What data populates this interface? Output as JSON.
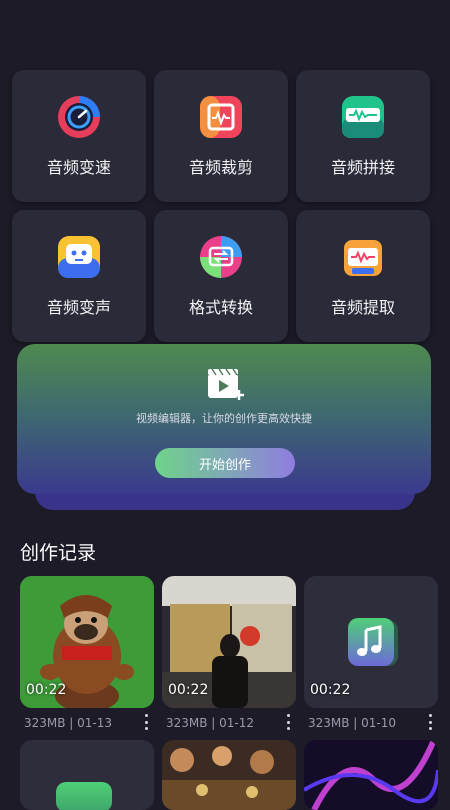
{
  "tools": [
    {
      "label": "音频变速",
      "icon": "speed-dial-icon"
    },
    {
      "label": "音频裁剪",
      "icon": "crop-audio-icon"
    },
    {
      "label": "音频拼接",
      "icon": "splice-audio-icon"
    },
    {
      "label": "音频变声",
      "icon": "voice-change-robot-icon"
    },
    {
      "label": "格式转换",
      "icon": "format-convert-icon"
    },
    {
      "label": "音频提取",
      "icon": "extract-audio-icon"
    }
  ],
  "banner": {
    "description": "视频编辑器，让你的创作更高效快捷",
    "start_button": "开始创作"
  },
  "records": {
    "title": "创作记录",
    "items": [
      {
        "duration": "00:22",
        "meta": "323MB | 01-13",
        "thumb": "dog-costume-photo"
      },
      {
        "duration": "00:22",
        "meta": "323MB | 01-12",
        "thumb": "street-person-photo"
      },
      {
        "duration": "00:22",
        "meta": "323MB | 01-10",
        "thumb": "music-note-icon"
      }
    ]
  }
}
